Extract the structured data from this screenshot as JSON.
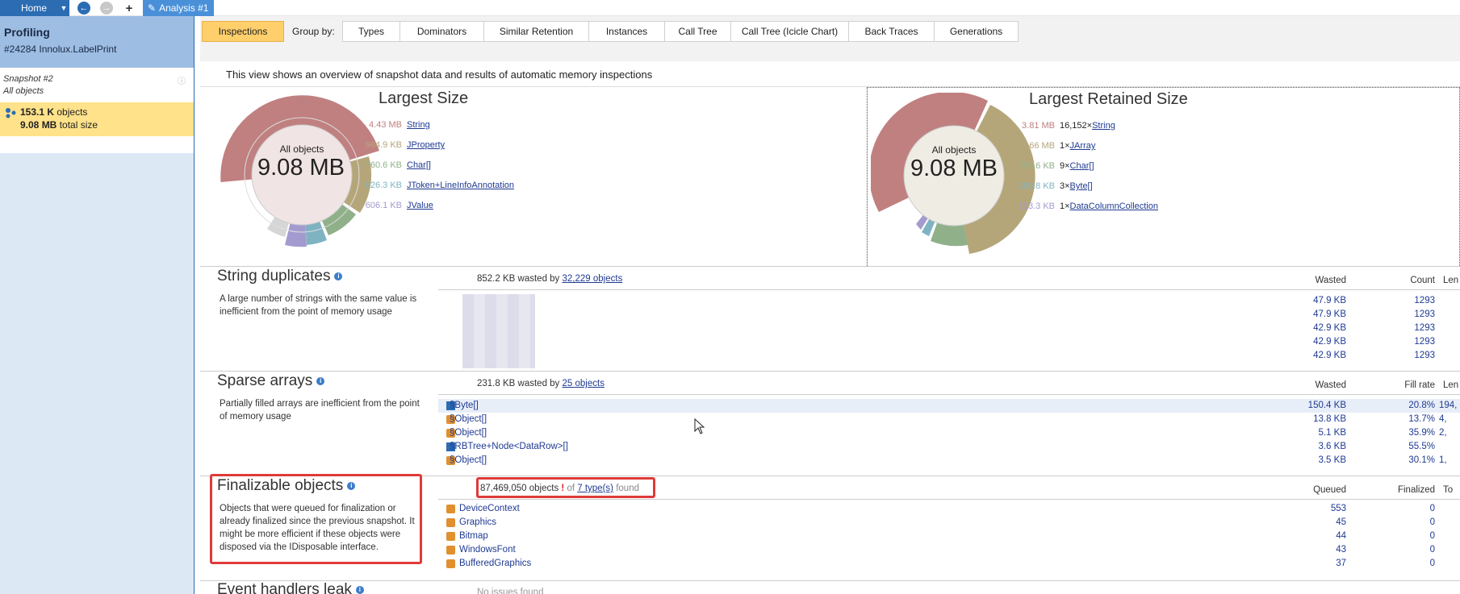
{
  "topbar": {
    "home_label": "Home",
    "tab_label": "Analysis #1"
  },
  "sidebar": {
    "title": "Profiling",
    "process": "#24284 Innolux.LabelPrint",
    "snapshot_name": "Snapshot #2",
    "snapshot_scope": "All objects",
    "objects_value": "153.1 K",
    "objects_label": "objects",
    "size_value": "9.08 MB",
    "size_label": "total size"
  },
  "toolbar": {
    "inspections": "Inspections",
    "group_by": "Group by:",
    "tabs": [
      "Types",
      "Dominators",
      "Similar Retention",
      "Instances",
      "Call Tree",
      "Call Tree (Icicle Chart)",
      "Back Traces",
      "Generations"
    ]
  },
  "overview_text": "This view shows an overview of snapshot data and results of automatic memory inspections",
  "largest_size": {
    "title": "Largest Size",
    "center_label": "All objects",
    "center_value": "9.08 MB",
    "items": [
      {
        "size": "4.43 MB",
        "name": "String",
        "color": "#c08080"
      },
      {
        "size": "984.9 KB",
        "name": "JProperty",
        "color": "#b5a67a"
      },
      {
        "size": "760.6 KB",
        "name": "Char[]",
        "color": "#90b08a"
      },
      {
        "size": "626.3 KB",
        "name": "JToken+LineInfoAnnotation",
        "color": "#7fb3c2"
      },
      {
        "size": "606.1 KB",
        "name": "JValue",
        "color": "#a39bd0"
      }
    ]
  },
  "largest_retained": {
    "title": "Largest Retained Size",
    "center_label": "All objects",
    "center_value": "9.08 MB",
    "items": [
      {
        "size": "3.81 MB",
        "count": "16,152×",
        "name": "String",
        "color": "#c08080"
      },
      {
        "size": "3.66 MB",
        "count": "1×",
        "name": "JArray",
        "color": "#b5a67a"
      },
      {
        "size": "759.6 KB",
        "count": "9×",
        "name": "Char[]",
        "color": "#90b08a"
      },
      {
        "size": "199.8 KB",
        "count": "3×",
        "name": "Byte[]",
        "color": "#7fb3c2"
      },
      {
        "size": "123.3 KB",
        "count": "1×",
        "name": "DataColumnCollection",
        "color": "#a39bd0"
      }
    ]
  },
  "string_duplicates": {
    "title": "String duplicates",
    "desc": "A large number of strings with the same value is inefficient from the point of memory usage",
    "wasted_size": "852.2 KB",
    "wasted_by": "wasted by",
    "objects_link": "32,229 objects",
    "col_wasted": "Wasted",
    "col_count": "Count",
    "col_len": "Len",
    "rows": [
      {
        "wasted": "47.9 KB",
        "count": "1293"
      },
      {
        "wasted": "47.9 KB",
        "count": "1293"
      },
      {
        "wasted": "42.9 KB",
        "count": "1293"
      },
      {
        "wasted": "42.9 KB",
        "count": "1293"
      },
      {
        "wasted": "42.9 KB",
        "count": "1293"
      }
    ]
  },
  "sparse_arrays": {
    "title": "Sparse arrays",
    "desc": "Partially filled arrays are inefficient from the point of memory usage",
    "wasted_size": "231.8 KB",
    "wasted_by": "wasted by",
    "objects_link": "25 objects",
    "col_wasted": "Wasted",
    "col_fill": "Fill rate",
    "col_len": "Len",
    "rows": [
      {
        "name": "§Byte[]",
        "wasted": "150.4 KB",
        "fill": "20.8%",
        "len": "194,"
      },
      {
        "name": "§Object[]",
        "wasted": "13.8 KB",
        "fill": "13.7%",
        "len": "4,"
      },
      {
        "name": "§Object[]",
        "wasted": "5.1 KB",
        "fill": "35.9%",
        "len": "2,"
      },
      {
        "name": "§RBTree+Node<DataRow>[]",
        "wasted": "3.6 KB",
        "fill": "55.5%",
        "len": ""
      },
      {
        "name": "§Object[]",
        "wasted": "3.5 KB",
        "fill": "30.1%",
        "len": "1,"
      }
    ]
  },
  "finalizable": {
    "title": "Finalizable objects",
    "desc": "Objects that were queued for finalization or already finalized since the previous snapshot. It might be more efficient if these objects were disposed via the IDisposable interface.",
    "objects_count": "87,469,050 objects",
    "excl": "!",
    "of": "of",
    "types_link": "7 type(s)",
    "found": "found",
    "col_queued": "Queued",
    "col_finalized": "Finalized",
    "col_total": "To",
    "rows": [
      {
        "name": "DeviceContext",
        "queued": "553",
        "finalized": "0"
      },
      {
        "name": "Graphics",
        "queued": "45",
        "finalized": "0"
      },
      {
        "name": "Bitmap",
        "queued": "44",
        "finalized": "0"
      },
      {
        "name": "WindowsFont",
        "queued": "43",
        "finalized": "0"
      },
      {
        "name": "BufferedGraphics",
        "queued": "37",
        "finalized": "0"
      }
    ]
  },
  "event_handlers": {
    "title": "Event handlers leak",
    "no_issues": "No issues found"
  }
}
